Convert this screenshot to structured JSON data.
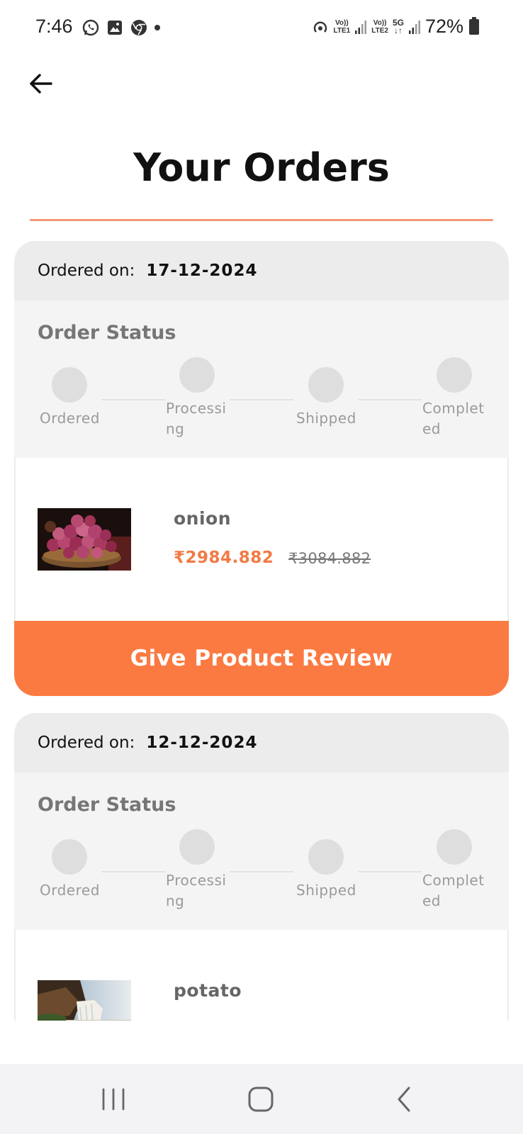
{
  "status_bar": {
    "time": "7:46",
    "left_icons": [
      "whatsapp-icon",
      "gallery-icon",
      "chrome-icon",
      "dot"
    ],
    "sim1_label_top": "Vo))",
    "sim1_label_bottom": "LTE1",
    "sim2_label_top": "Vo))",
    "sim2_label_bottom": "LTE2",
    "network_type": "5G",
    "battery": "72%"
  },
  "header": {
    "back_icon": "arrow-left-icon",
    "title": "Your Orders",
    "accent_color": "#f0855a"
  },
  "orders": [
    {
      "date_label": "Ordered on:",
      "date_value": "17-12-2024",
      "status_heading": "Order Status",
      "steps": [
        "Ordered",
        "Processing",
        "Shipped",
        "Completed"
      ],
      "product_name": "onion",
      "price_now": "₹2984.882",
      "price_was": "₹3084.882",
      "review_label": "Give Product Review"
    },
    {
      "date_label": "Ordered on:",
      "date_value": "12-12-2024",
      "status_heading": "Order Status",
      "steps": [
        "Ordered",
        "Processing",
        "Shipped",
        "Completed"
      ],
      "product_name": "potato"
    }
  ],
  "colors": {
    "button": "#fb7a42",
    "price": "#f17a45",
    "card_header": "#ececec",
    "status_bg": "#f4f4f4"
  },
  "nav_bar": {
    "buttons": [
      "recents-icon",
      "home-icon",
      "back-nav-icon"
    ]
  }
}
